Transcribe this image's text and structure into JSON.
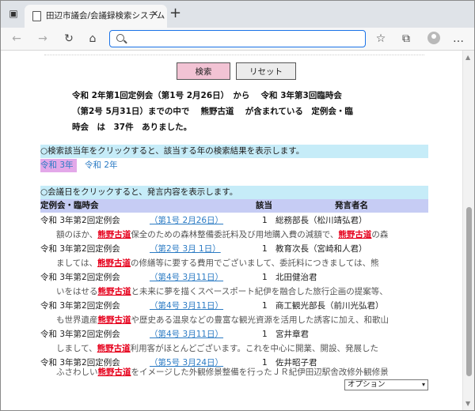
{
  "browser": {
    "tab_title": "田辺市議会/会議録検索システム",
    "tab_close": "✕",
    "new_tab": "+",
    "nav_back": "←",
    "nav_forward": "→",
    "nav_reload": "↻",
    "nav_home": "⌂",
    "address_value": "",
    "toolbar_star": "☆",
    "toolbar_collections": "⧉",
    "toolbar_menu": "…"
  },
  "search": {
    "search_label": "検索",
    "reset_label": "リセット"
  },
  "summary": {
    "line1": "令和 2年第1回定例会（第1号 2月26日）　から　 令和 3年第3回臨時会",
    "line2": "（第2号 5月31日）までの中で　 熊野古道　 が含まれている　定例会・臨",
    "line3": "時会　は　37件　ありました。"
  },
  "year_section": {
    "help": "○検索該当年をクリックすると、該当する年の検索結果を表示します。",
    "years": [
      "令和 3年",
      "令和 2年"
    ]
  },
  "date_section": {
    "help": "○会議日をクリックすると、発言内容を表示します。",
    "columns": {
      "meeting": "定例会・臨時会",
      "count": "該当",
      "speaker": "発言者名"
    }
  },
  "keyword": "熊野古道",
  "results": [
    {
      "meeting": "令和 3年第2回定例会",
      "date": "（第1号 2月26日）",
      "count": "1",
      "speaker": "総務部長（松川靖弘君）",
      "excerpt": [
        "額のほか、",
        "保全のための森林整備委託料及び用地購入費の減額で、",
        "の森"
      ]
    },
    {
      "meeting": "令和 3年第2回定例会",
      "date": "（第2号 3月 1日）",
      "count": "1",
      "speaker": "教育次長（宮崎和人君）",
      "excerpt": [
        "ましては、",
        "の修繕等に要する費用でございまして、委託料につきましては、熊"
      ]
    },
    {
      "meeting": "令和 3年第2回定例会",
      "date": "（第4号 3月11日）",
      "count": "1",
      "speaker": "北田健治君",
      "excerpt": [
        "いをはせる",
        "と未来に夢を描くスペースポート紀伊を融合した旅行企画の提案等、"
      ]
    },
    {
      "meeting": "令和 3年第2回定例会",
      "date": "（第4号 3月11日）",
      "count": "1",
      "speaker": "商工観光部長（前川光弘君）",
      "excerpt": [
        "も世界遺産",
        "や歴史ある温泉などの豊富な観光資源を活用した誘客に加え、和歌山"
      ]
    },
    {
      "meeting": "令和 3年第2回定例会",
      "date": "（第4号 3月11日）",
      "count": "1",
      "speaker": "宮井章君",
      "excerpt": [
        "しまして、",
        "利用客がほとんどございます。これを中心に開業、開設、発展した"
      ]
    },
    {
      "meeting": "令和 3年第2回定例会",
      "date": "（第5号 3月24日）",
      "count": "1",
      "speaker": "佐井昭子君",
      "excerpt": [
        "ふさわしい",
        "をイメージした外観修景整備を行ったＪＲ紀伊田辺駅舎改修外観修景"
      ]
    }
  ],
  "option_select": {
    "value": "オプション",
    "arrow": "▾"
  },
  "colors": {
    "accent_search": "#f2c3d4",
    "info_bar": "#c6ecf8",
    "header_bar": "#c6ccf4",
    "highlight": "#e6001c",
    "link": "#2b7bc4"
  }
}
